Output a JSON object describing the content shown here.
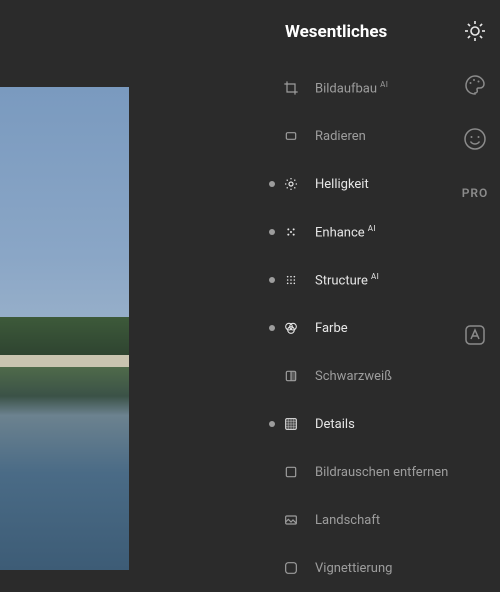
{
  "panel": {
    "title": "Wesentliches",
    "tools": [
      {
        "label": "Bildaufbau",
        "ai": true,
        "modified": false,
        "icon": "crop"
      },
      {
        "label": "Radieren",
        "ai": false,
        "modified": false,
        "icon": "eraser"
      },
      {
        "label": "Helligkeit",
        "ai": false,
        "modified": true,
        "icon": "brightness"
      },
      {
        "label": "Enhance",
        "ai": true,
        "modified": true,
        "icon": "enhance"
      },
      {
        "label": "Structure",
        "ai": true,
        "modified": true,
        "icon": "structure"
      },
      {
        "label": "Farbe",
        "ai": false,
        "modified": true,
        "icon": "color"
      },
      {
        "label": "Schwarzweiß",
        "ai": false,
        "modified": false,
        "icon": "bw"
      },
      {
        "label": "Details",
        "ai": false,
        "modified": true,
        "icon": "details"
      },
      {
        "label": "Bildrauschen entfernen",
        "ai": false,
        "modified": false,
        "icon": "noise"
      },
      {
        "label": "Landschaft",
        "ai": false,
        "modified": false,
        "icon": "landscape"
      },
      {
        "label": "Vignettierung",
        "ai": false,
        "modified": false,
        "icon": "vignette"
      }
    ]
  },
  "rail": {
    "pro_label": "PRO"
  }
}
